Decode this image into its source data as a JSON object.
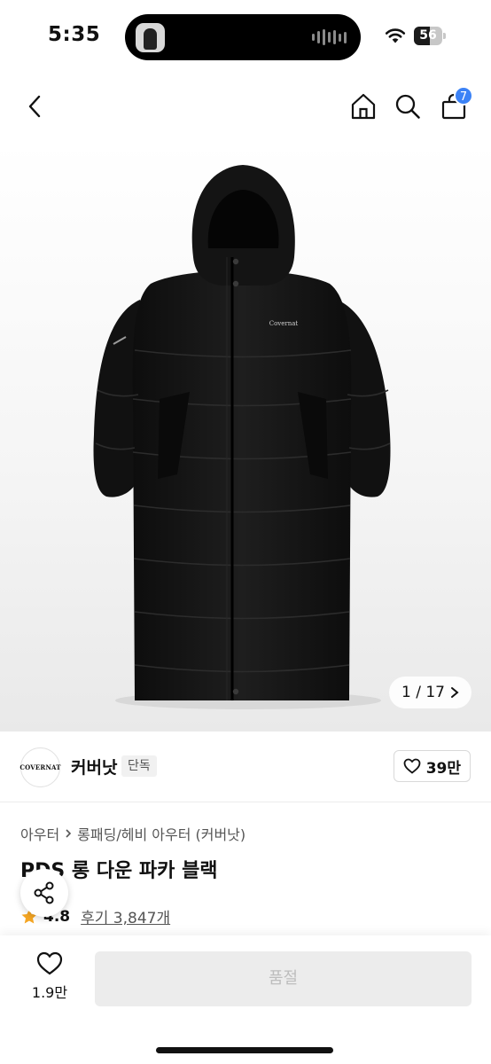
{
  "status_bar": {
    "time": "5:35",
    "battery": "56",
    "battery_level": 0.56
  },
  "header": {
    "cart_count": "7"
  },
  "gallery": {
    "counter": "1 / 17",
    "logo_text": "Covernat"
  },
  "brand": {
    "logo_text": "COVERNAT",
    "name": "커버낫",
    "tag": "단독",
    "likes": "39만"
  },
  "product": {
    "breadcrumb": [
      "아우터",
      "롱패딩/헤비 아우터 (커버낫)"
    ],
    "title": "PDS 롱 다운 파카 블랙",
    "rating": "4.8",
    "reviews": "후기 3,847개"
  },
  "bottom_bar": {
    "wish_count": "1.9만",
    "buy_label": "품절"
  },
  "colors": {
    "badge": "#3b82f6",
    "star": "#f5a623",
    "soldout_bg": "#ececec"
  },
  "icons": [
    "back-icon",
    "home-icon",
    "search-icon",
    "cart-icon",
    "heart-icon",
    "share-icon",
    "star-icon",
    "chevron-right-icon",
    "wifi-icon"
  ]
}
